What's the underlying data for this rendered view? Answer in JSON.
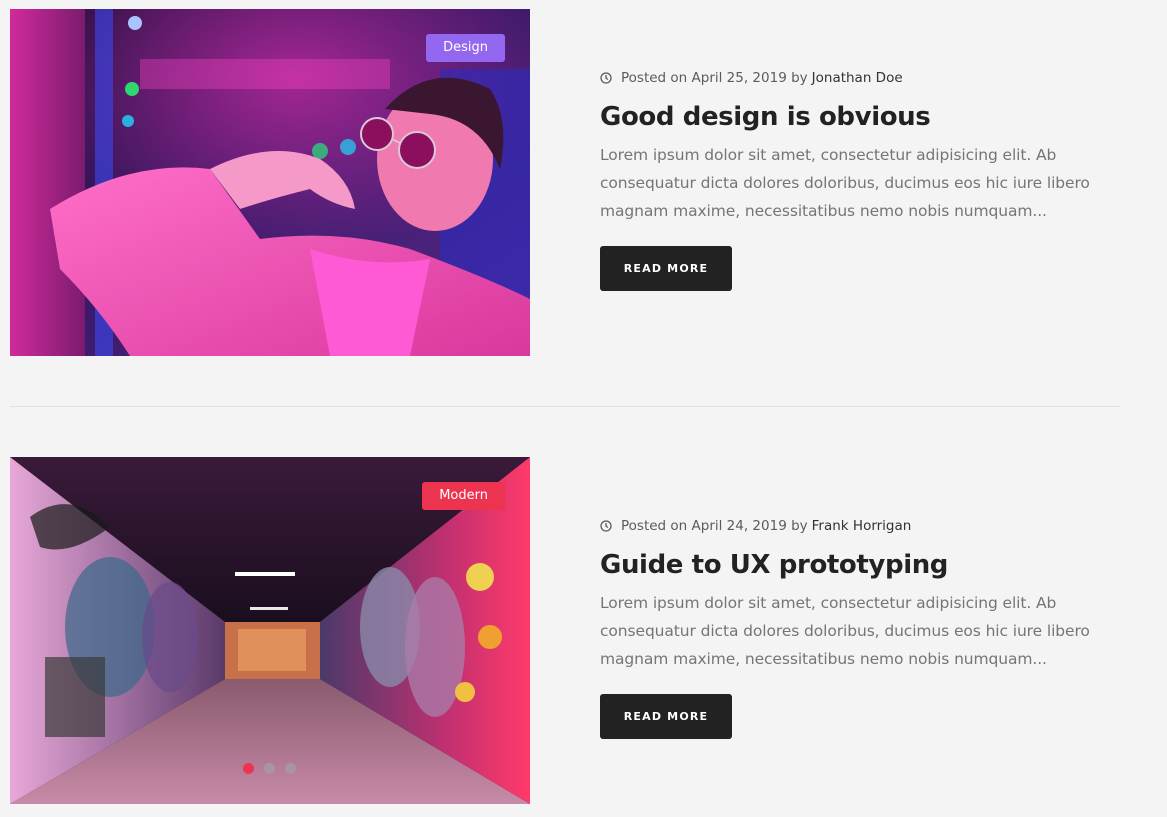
{
  "colors": {
    "background": "#f4f4f4",
    "title": "#222222",
    "excerpt": "#757575",
    "button": "#222222",
    "badge_design": "#9467f0",
    "badge_modern": "#ec3450",
    "dot_active": "#ec3450",
    "dot_inactive": "#a79aa5"
  },
  "posts": [
    {
      "category": "Design",
      "posted_prefix": "Posted on April 25, 2019 by",
      "author": "Jonathan Doe",
      "title": "Good design is obvious",
      "excerpt": "Lorem ipsum dolor sit amet, consectetur adipisicing elit. Ab consequatur dicta dolores doloribus, ducimus eos hic iure libero magnam maxime, necessitatibus nemo nobis numquam...",
      "button": "READ MORE",
      "image": "man-pink-sunglasses-neon-photo",
      "meta_icon": "clock-icon"
    },
    {
      "category": "Modern",
      "posted_prefix": "Posted on April 24, 2019 by",
      "author": "Frank Horrigan",
      "title": "Guide to UX prototyping",
      "excerpt": "Lorem ipsum dolor sit amet, consectetur adipisicing elit. Ab consequatur dicta dolores doloribus, ducimus eos hic iure libero magnam maxime, necessitatibus nemo nobis numquam...",
      "button": "READ MORE",
      "image": "graffiti-tunnel-photo",
      "meta_icon": "clock-icon",
      "carousel": {
        "slides": 3,
        "active": 1
      }
    }
  ]
}
